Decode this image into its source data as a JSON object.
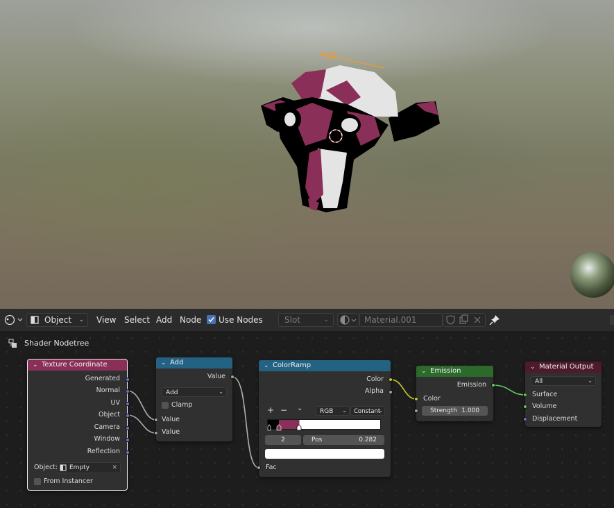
{
  "header": {
    "editor_type_icon": "node-editor-icon",
    "object_mode": "Object",
    "menu": [
      "View",
      "Select",
      "Add",
      "Node"
    ],
    "use_nodes_label": "Use Nodes",
    "use_nodes_checked": true,
    "slot_label": "Slot",
    "material_name": "Material.001"
  },
  "breadcrumb": {
    "label": "Shader Nodetree"
  },
  "nodes": {
    "texcoord": {
      "title": "Texture Coordinate",
      "header_color": "#8a2f57",
      "outputs": [
        "Generated",
        "Normal",
        "UV",
        "Object",
        "Camera",
        "Window",
        "Reflection"
      ],
      "object_label": "Object:",
      "object_value": "Empty",
      "from_instancer_label": "From Instancer"
    },
    "add": {
      "title": "Add",
      "header_color": "#246283",
      "output": "Value",
      "operation": "Add",
      "clamp_label": "Clamp",
      "inputs": [
        "Value",
        "Value"
      ]
    },
    "colorramp": {
      "title": "ColorRamp",
      "header_color": "#246283",
      "outputs": [
        "Color",
        "Alpha"
      ],
      "plus": "+",
      "minus": "−",
      "mode": "RGB",
      "interpolation": "Constant",
      "index": "2",
      "pos_label": "Pos",
      "pos_value": "0.282",
      "input": "Fac"
    },
    "emission": {
      "title": "Emission",
      "header_color": "#2b6a2b",
      "output": "Emission",
      "color_label": "Color",
      "strength_label": "Strength",
      "strength_value": "1.000"
    },
    "output": {
      "title": "Material Output",
      "header_color": "#4f1a2a",
      "target": "All",
      "inputs": [
        "Surface",
        "Volume",
        "Displacement"
      ]
    }
  },
  "colors": {
    "ramp_magenta": "#8a2f57",
    "link": "#b0b0b0",
    "link_yellow": "#c7c729",
    "link_green": "#63c763"
  }
}
